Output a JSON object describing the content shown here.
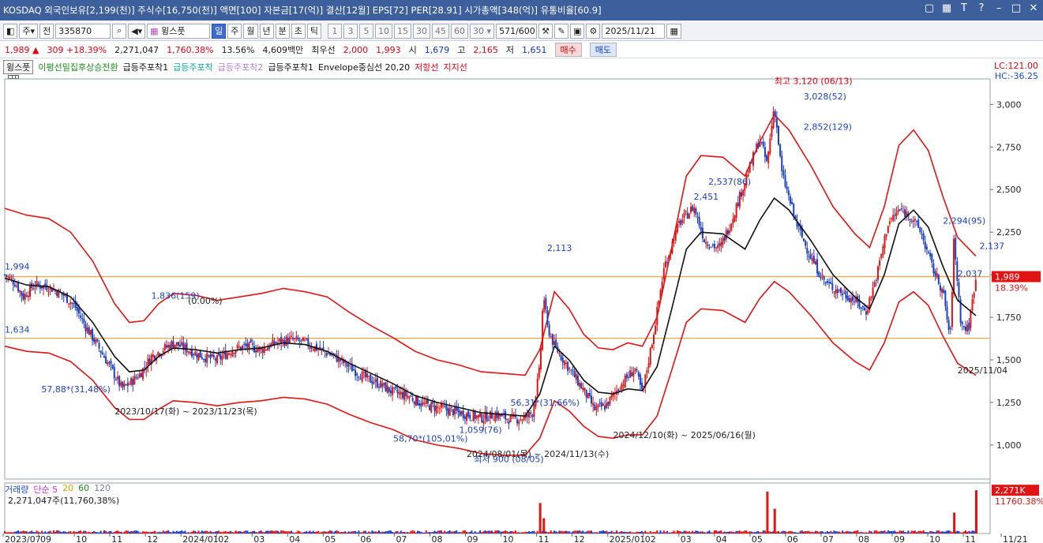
{
  "titlebar": {
    "text": "KOSDAQ 외국인보유[2,199(천)] 주식수[16,750(천)] 액면[100] 자본금[17(억)] 결산[12월] EPS[72] PER[28.91] 시가총액[348(억)] 유통비율[60.9]",
    "icons": [
      "restore-icon",
      "grid-icon",
      "font-icon",
      "help-icon",
      "minimize-icon",
      "maximize-icon",
      "close-icon"
    ]
  },
  "toolbar": {
    "type_select": "주",
    "prev_label": "전",
    "code": "335870",
    "name": "윙스풋",
    "periods": [
      "일",
      "주",
      "월",
      "년",
      "분",
      "초",
      "틱"
    ],
    "active_period": "일",
    "minute_options": [
      "1",
      "3",
      "5",
      "10",
      "15",
      "30",
      "45",
      "60"
    ],
    "minute_value": "30",
    "count": "571",
    "count_total": "/600",
    "date": "2025/11/21"
  },
  "quote": {
    "price": "1,989",
    "arrow": "▲",
    "change": "309",
    "change_pct": "+18.39%",
    "volume": "2,271,047",
    "volume_pct": "1,760.38%",
    "turnover": "13.56%",
    "amount": "4,609백만",
    "best_label": "최우선",
    "ask": "2,000",
    "bid": "1,993",
    "open_label": "시",
    "open": "1,679",
    "high_label": "고",
    "high": "2,165",
    "low_label": "저",
    "low": "1,651",
    "buy_label": "매수",
    "sell_label": "매도"
  },
  "legend": {
    "stock": "윙스풋",
    "items": [
      {
        "label": "이평선밀집후상승전환",
        "color": "#1a8a1a"
      },
      {
        "label": "급등주포착1",
        "color": "#111111"
      },
      {
        "label": "급등주포착",
        "color": "#14a7a7"
      },
      {
        "label": "급등주포착2",
        "color": "#b380d9"
      },
      {
        "label": "급등주포착1",
        "color": "#111111"
      },
      {
        "label": "Envelope중심선 20,20",
        "color": "#111111"
      },
      {
        "label": "저항선",
        "color": "#e60012"
      },
      {
        "label": "지지선",
        "color": "#e60012"
      }
    ],
    "lc": "LC:121.00",
    "hc": "HC:-36.25"
  },
  "chart_data": [
    {
      "type": "candlestick",
      "x_labels": [
        "2023/07",
        "09",
        "10",
        "11",
        "12",
        "2024/01",
        "02",
        "03",
        "04",
        "05",
        "06",
        "07",
        "08",
        "09",
        "10",
        "11",
        "12",
        "2025/01",
        "02",
        "03",
        "04",
        "05",
        "06",
        "07",
        "08",
        "09",
        "10",
        "11",
        "11/21"
      ],
      "y_ticks": [
        1000,
        1250,
        1500,
        1750,
        2000,
        2250,
        2500,
        2750,
        3000
      ],
      "ylim": [
        800,
        3150
      ],
      "last_price": "1,989",
      "last_price_pct": "18.39%",
      "price_path": [
        [
          0,
          2000
        ],
        [
          3,
          1950
        ],
        [
          5,
          1870
        ],
        [
          8,
          1940
        ],
        [
          12,
          1930
        ],
        [
          16,
          1880
        ],
        [
          19,
          1820
        ],
        [
          22,
          1700
        ],
        [
          26,
          1560
        ],
        [
          29,
          1450
        ],
        [
          32,
          1330
        ],
        [
          34,
          1360
        ],
        [
          37,
          1420
        ],
        [
          40,
          1520
        ],
        [
          43,
          1560
        ],
        [
          46,
          1600
        ],
        [
          50,
          1560
        ],
        [
          54,
          1520
        ],
        [
          58,
          1500
        ],
        [
          62,
          1560
        ],
        [
          66,
          1580
        ],
        [
          70,
          1560
        ],
        [
          74,
          1600
        ],
        [
          78,
          1620
        ],
        [
          82,
          1600
        ],
        [
          86,
          1560
        ],
        [
          90,
          1520
        ],
        [
          94,
          1460
        ],
        [
          98,
          1400
        ],
        [
          102,
          1360
        ],
        [
          106,
          1310
        ],
        [
          110,
          1290
        ],
        [
          114,
          1240
        ],
        [
          118,
          1220
        ],
        [
          122,
          1200
        ],
        [
          126,
          1180
        ],
        [
          130,
          1160
        ],
        [
          134,
          1180
        ],
        [
          138,
          1150
        ],
        [
          142,
          1160
        ],
        [
          144,
          1190
        ],
        [
          146,
          1450
        ],
        [
          147,
          1900
        ],
        [
          148,
          1700
        ],
        [
          150,
          1580
        ],
        [
          154,
          1450
        ],
        [
          158,
          1320
        ],
        [
          161,
          1210
        ],
        [
          164,
          1230
        ],
        [
          168,
          1350
        ],
        [
          172,
          1450
        ],
        [
          174,
          1300
        ],
        [
          177,
          1650
        ],
        [
          180,
          2050
        ],
        [
          184,
          2300
        ],
        [
          188,
          2400
        ],
        [
          191,
          2200
        ],
        [
          195,
          2150
        ],
        [
          198,
          2300
        ],
        [
          202,
          2550
        ],
        [
          206,
          2800
        ],
        [
          208,
          2650
        ],
        [
          210,
          3000
        ],
        [
          212,
          2600
        ],
        [
          216,
          2300
        ],
        [
          220,
          2100
        ],
        [
          224,
          1950
        ],
        [
          228,
          1900
        ],
        [
          232,
          1850
        ],
        [
          235,
          1780
        ],
        [
          238,
          2000
        ],
        [
          241,
          2300
        ],
        [
          244,
          2380
        ],
        [
          247,
          2350
        ],
        [
          250,
          2250
        ],
        [
          253,
          2050
        ],
        [
          256,
          1900
        ],
        [
          258,
          1620
        ],
        [
          259,
          2200
        ],
        [
          261,
          1700
        ],
        [
          263,
          1680
        ],
        [
          265,
          2000
        ]
      ],
      "ma_path": [
        [
          0,
          1980
        ],
        [
          6,
          1940
        ],
        [
          12,
          1930
        ],
        [
          18,
          1870
        ],
        [
          24,
          1720
        ],
        [
          30,
          1520
        ],
        [
          34,
          1430
        ],
        [
          38,
          1440
        ],
        [
          42,
          1520
        ],
        [
          46,
          1570
        ],
        [
          52,
          1560
        ],
        [
          58,
          1540
        ],
        [
          64,
          1560
        ],
        [
          70,
          1570
        ],
        [
          76,
          1600
        ],
        [
          82,
          1590
        ],
        [
          88,
          1550
        ],
        [
          94,
          1480
        ],
        [
          100,
          1420
        ],
        [
          106,
          1360
        ],
        [
          112,
          1290
        ],
        [
          118,
          1250
        ],
        [
          124,
          1220
        ],
        [
          130,
          1190
        ],
        [
          136,
          1180
        ],
        [
          142,
          1170
        ],
        [
          146,
          1300
        ],
        [
          150,
          1580
        ],
        [
          154,
          1500
        ],
        [
          158,
          1380
        ],
        [
          162,
          1310
        ],
        [
          166,
          1300
        ],
        [
          170,
          1330
        ],
        [
          174,
          1320
        ],
        [
          178,
          1460
        ],
        [
          182,
          1800
        ],
        [
          186,
          2150
        ],
        [
          190,
          2250
        ],
        [
          196,
          2240
        ],
        [
          202,
          2150
        ],
        [
          206,
          2320
        ],
        [
          210,
          2450
        ],
        [
          214,
          2380
        ],
        [
          220,
          2200
        ],
        [
          226,
          2000
        ],
        [
          232,
          1870
        ],
        [
          236,
          1800
        ],
        [
          240,
          2000
        ],
        [
          244,
          2300
        ],
        [
          248,
          2380
        ],
        [
          252,
          2280
        ],
        [
          256,
          2050
        ],
        [
          260,
          1850
        ],
        [
          265,
          1760
        ]
      ],
      "upper_band": [
        [
          0,
          2390
        ],
        [
          6,
          2350
        ],
        [
          12,
          2330
        ],
        [
          18,
          2250
        ],
        [
          24,
          2080
        ],
        [
          30,
          1830
        ],
        [
          34,
          1720
        ],
        [
          38,
          1730
        ],
        [
          42,
          1830
        ],
        [
          46,
          1890
        ],
        [
          52,
          1880
        ],
        [
          58,
          1850
        ],
        [
          64,
          1870
        ],
        [
          70,
          1890
        ],
        [
          76,
          1920
        ],
        [
          82,
          1900
        ],
        [
          88,
          1870
        ],
        [
          94,
          1780
        ],
        [
          100,
          1700
        ],
        [
          106,
          1630
        ],
        [
          112,
          1550
        ],
        [
          118,
          1500
        ],
        [
          124,
          1470
        ],
        [
          130,
          1430
        ],
        [
          136,
          1420
        ],
        [
          142,
          1410
        ],
        [
          146,
          1560
        ],
        [
          150,
          1900
        ],
        [
          154,
          1800
        ],
        [
          158,
          1650
        ],
        [
          162,
          1570
        ],
        [
          166,
          1560
        ],
        [
          170,
          1600
        ],
        [
          174,
          1580
        ],
        [
          178,
          1750
        ],
        [
          182,
          2160
        ],
        [
          186,
          2580
        ],
        [
          190,
          2700
        ],
        [
          196,
          2690
        ],
        [
          202,
          2580
        ],
        [
          206,
          2780
        ],
        [
          210,
          2940
        ],
        [
          214,
          2850
        ],
        [
          220,
          2640
        ],
        [
          226,
          2400
        ],
        [
          232,
          2240
        ],
        [
          236,
          2160
        ],
        [
          240,
          2400
        ],
        [
          244,
          2760
        ],
        [
          248,
          2850
        ],
        [
          252,
          2730
        ],
        [
          256,
          2460
        ],
        [
          260,
          2220
        ],
        [
          265,
          2110
        ]
      ],
      "lower_band": [
        [
          0,
          1580
        ],
        [
          6,
          1550
        ],
        [
          12,
          1540
        ],
        [
          18,
          1490
        ],
        [
          24,
          1380
        ],
        [
          30,
          1220
        ],
        [
          34,
          1150
        ],
        [
          38,
          1150
        ],
        [
          42,
          1210
        ],
        [
          46,
          1260
        ],
        [
          52,
          1250
        ],
        [
          58,
          1230
        ],
        [
          64,
          1250
        ],
        [
          70,
          1260
        ],
        [
          76,
          1280
        ],
        [
          82,
          1270
        ],
        [
          88,
          1240
        ],
        [
          94,
          1180
        ],
        [
          100,
          1130
        ],
        [
          106,
          1090
        ],
        [
          112,
          1030
        ],
        [
          118,
          1000
        ],
        [
          124,
          980
        ],
        [
          130,
          950
        ],
        [
          136,
          940
        ],
        [
          142,
          940
        ],
        [
          146,
          1040
        ],
        [
          150,
          1260
        ],
        [
          154,
          1200
        ],
        [
          158,
          1110
        ],
        [
          162,
          1050
        ],
        [
          166,
          1040
        ],
        [
          170,
          1060
        ],
        [
          174,
          1060
        ],
        [
          178,
          1170
        ],
        [
          182,
          1440
        ],
        [
          186,
          1720
        ],
        [
          190,
          1800
        ],
        [
          196,
          1790
        ],
        [
          202,
          1720
        ],
        [
          206,
          1860
        ],
        [
          210,
          1960
        ],
        [
          214,
          1900
        ],
        [
          220,
          1760
        ],
        [
          226,
          1600
        ],
        [
          232,
          1490
        ],
        [
          236,
          1440
        ],
        [
          240,
          1600
        ],
        [
          244,
          1840
        ],
        [
          248,
          1900
        ],
        [
          252,
          1820
        ],
        [
          256,
          1640
        ],
        [
          260,
          1480
        ],
        [
          265,
          1410
        ]
      ],
      "resistance_line": 1989,
      "support_line": 1627,
      "annotations": [
        {
          "text": "최고 3,120 (06/13)",
          "x": 210,
          "y": 3120,
          "color": "#e60012"
        },
        {
          "text": "최저 900 (08/05)",
          "x": 128,
          "y": 900,
          "color": "#1a3fc4"
        },
        {
          "text": "1,994",
          "x": 0,
          "y": 2030,
          "color": "#1a3fc4"
        },
        {
          "text": "1,634",
          "x": 0,
          "y": 1660,
          "color": "#1a3fc4"
        },
        {
          "text": "1,836(159)",
          "x": 40,
          "y": 1860,
          "color": "#1a3fc4"
        },
        {
          "text": "(0.00%)",
          "x": 50,
          "y": 1830,
          "color": "#222222"
        },
        {
          "text": "57,88*(31,48%)",
          "x": 10,
          "y": 1310,
          "color": "#1a3fc4"
        },
        {
          "text": "2023/10/17(화) ~ 2023/11/23(목)",
          "x": 30,
          "y": 1180,
          "color": "#222222"
        },
        {
          "text": "2,113",
          "x": 148,
          "y": 2140,
          "color": "#1a3fc4"
        },
        {
          "text": "1,059(76)",
          "x": 124,
          "y": 1070,
          "color": "#1a3fc4"
        },
        {
          "text": "58,70*(105,01%)",
          "x": 106,
          "y": 1020,
          "color": "#1a3fc4"
        },
        {
          "text": "2024/08/01(목) ~ 2024/11/13(수)",
          "x": 126,
          "y": 930,
          "color": "#222222"
        },
        {
          "text": "56,31*(31,66%)",
          "x": 138,
          "y": 1230,
          "color": "#1a3fc4"
        },
        {
          "text": "2024/12/10(화) ~ 2025/06/16(월)",
          "x": 166,
          "y": 1040,
          "color": "#222222"
        },
        {
          "text": "2,537(86)",
          "x": 192,
          "y": 2530,
          "color": "#1a3fc4"
        },
        {
          "text": "2,451",
          "x": 188,
          "y": 2440,
          "color": "#1a3fc4"
        },
        {
          "text": "2,852(129)",
          "x": 218,
          "y": 2850,
          "color": "#1a3fc4"
        },
        {
          "text": "3,028(52)",
          "x": 218,
          "y": 3030,
          "color": "#1a3fc4"
        },
        {
          "text": "2,294(95)",
          "x": 256,
          "y": 2300,
          "color": "#1a3fc4"
        },
        {
          "text": "2,137",
          "x": 266,
          "y": 2150,
          "color": "#1a3fc4"
        },
        {
          "text": "2,037",
          "x": 260,
          "y": 1990,
          "color": "#1a3fc4"
        },
        {
          "text": "2025/11/04",
          "x": 260,
          "y": 1420,
          "color": "#222222"
        }
      ]
    },
    {
      "type": "bar",
      "title": "거래량",
      "legend": [
        {
          "label": "단순 5",
          "color": "#cc33cc"
        },
        {
          "label": "20",
          "color": "#e6a400"
        },
        {
          "label": "60",
          "color": "#1a8a1a"
        },
        {
          "label": "120",
          "color": "#7b7f87"
        }
      ],
      "current_volume": "2,271,047주(11,760,38%)",
      "axis_value": "2,271K",
      "axis_pct": "11760.38%",
      "spikes": [
        {
          "x": 146,
          "value": 1.6
        },
        {
          "x": 147,
          "value": 0.8
        },
        {
          "x": 208,
          "value": 2.2
        },
        {
          "x": 210,
          "value": 1.3
        },
        {
          "x": 259,
          "value": 1.1
        },
        {
          "x": 265,
          "value": 2.27
        }
      ]
    }
  ]
}
